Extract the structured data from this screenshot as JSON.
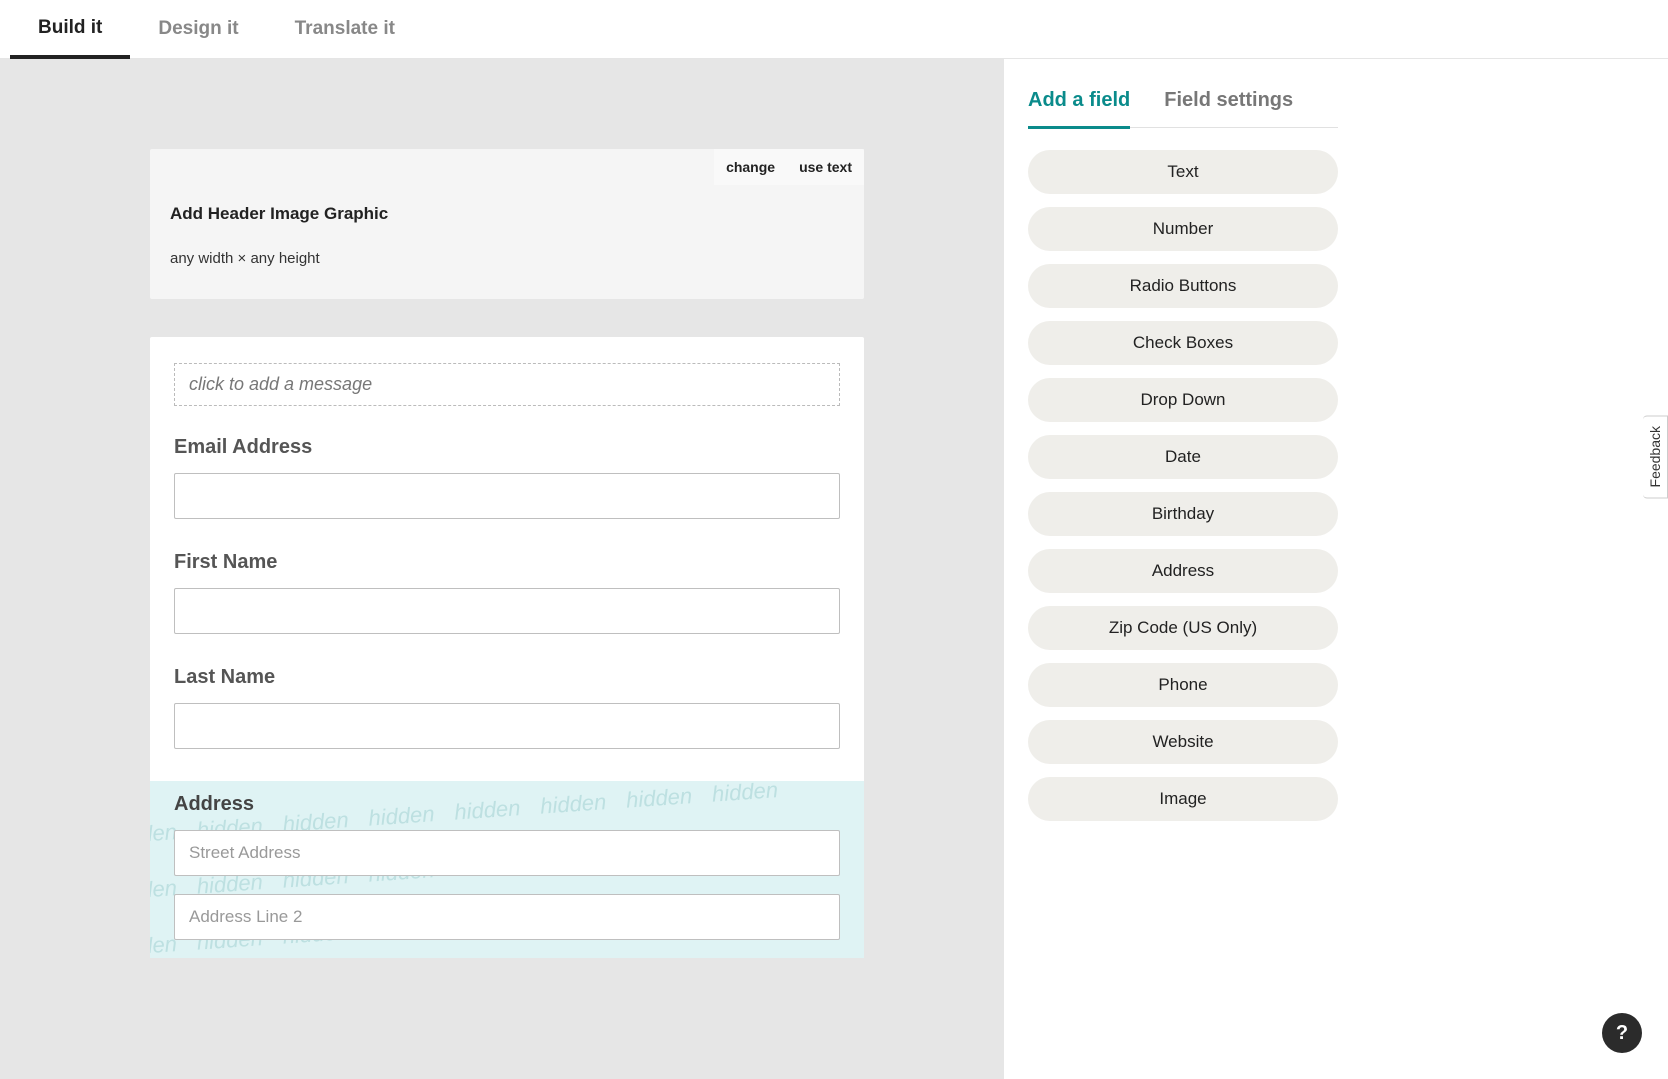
{
  "top_tabs": {
    "build": "Build it",
    "design": "Design it",
    "translate": "Translate it"
  },
  "header_card": {
    "change": "change",
    "use_text": "use text",
    "title": "Add Header Image Graphic",
    "subtitle": "any width × any height"
  },
  "form": {
    "message_placeholder": "click to add a message",
    "fields": {
      "email": {
        "label": "Email Address"
      },
      "first_name": {
        "label": "First Name"
      },
      "last_name": {
        "label": "Last Name"
      },
      "address": {
        "label": "Address",
        "street_placeholder": "Street Address",
        "line2_placeholder": "Address Line 2"
      }
    },
    "hidden_word": "hidden"
  },
  "sidebar": {
    "tabs": {
      "add": "Add a field",
      "settings": "Field settings"
    },
    "fields": [
      "Text",
      "Number",
      "Radio Buttons",
      "Check Boxes",
      "Drop Down",
      "Date",
      "Birthday",
      "Address",
      "Zip Code (US Only)",
      "Phone",
      "Website",
      "Image"
    ]
  },
  "feedback": "Feedback",
  "help": "?"
}
